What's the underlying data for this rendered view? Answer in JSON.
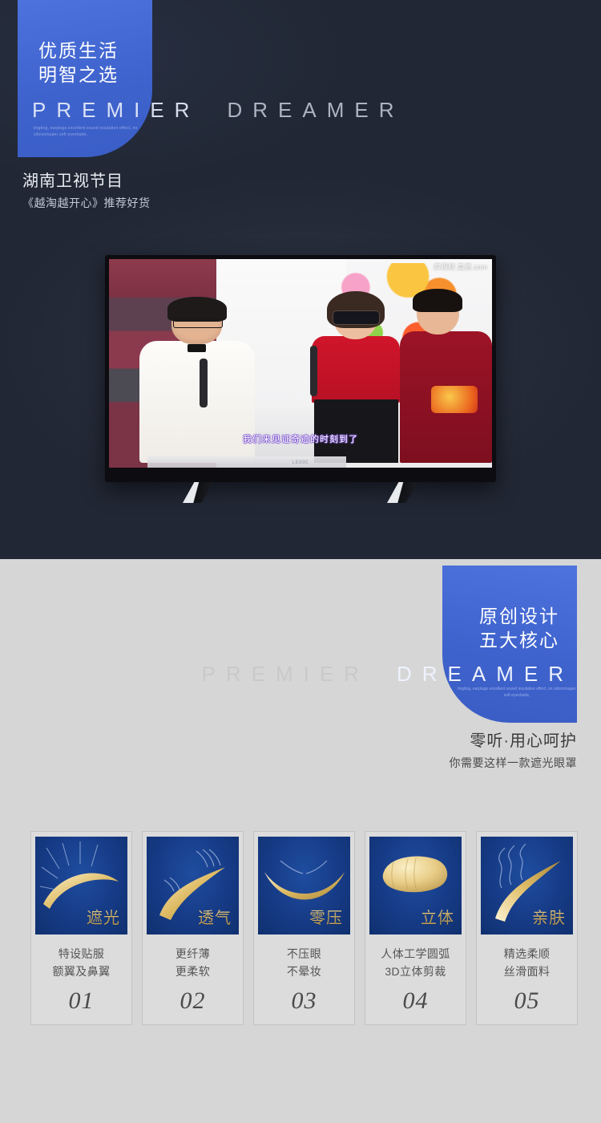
{
  "hero": {
    "badge_title_line1": "优质生活",
    "badge_title_line2": "明智之选",
    "wordmark_left": "PREMIER",
    "wordmark_right": "DREAMER",
    "microtext": "lingting, earplugs excellent sound insulation effect, no silicon/super soft eyeshade,",
    "caption_line1": "湖南卫视节目",
    "caption_line2": "《越淘越开心》推荐好货"
  },
  "tv": {
    "brand_logo": "LEOOC",
    "channel_logo": "疯视频\n高清.com",
    "subtitle": "我们来见证奇迹的时刻到了"
  },
  "light_section": {
    "badge_title_line1": "原创设计",
    "badge_title_line2": "五大核心",
    "wordmark_left": "PREMIER",
    "wordmark_right": "DREAMER",
    "microtext": "lingting, earplugs excellent sound insulation effect, on silicon/super soft eyeshade,",
    "caption_line1": "零听·用心呵护",
    "caption_line2": "你需要这样一款遮光眼罩"
  },
  "colors": {
    "hero_bg": "#212734",
    "light_bg": "#d6d6d6",
    "badge_blue": "#3f63cd",
    "card_blue": "#163b86",
    "gold": "#e2c272"
  },
  "feature_cards": [
    {
      "keyword": "遮光",
      "icon": "sunrise-rays-icon",
      "desc_line1": "特设贴服",
      "desc_line2": "额翼及鼻翼",
      "number": "01"
    },
    {
      "keyword": "透气",
      "icon": "airflow-wave-icon",
      "desc_line1": "更纤薄",
      "desc_line2": "更柔软",
      "number": "02"
    },
    {
      "keyword": "零压",
      "icon": "closed-eyes-icon",
      "desc_line1": "不压眼",
      "desc_line2": "不晕妆",
      "number": "03"
    },
    {
      "keyword": "立体",
      "icon": "3d-eyemask-icon",
      "desc_line1": "人体工学圆弧",
      "desc_line2": "3D立体剪裁",
      "number": "04"
    },
    {
      "keyword": "亲肤",
      "icon": "soft-fabric-icon",
      "desc_line1": "精选柔顺",
      "desc_line2": "丝滑面料",
      "number": "05"
    }
  ]
}
